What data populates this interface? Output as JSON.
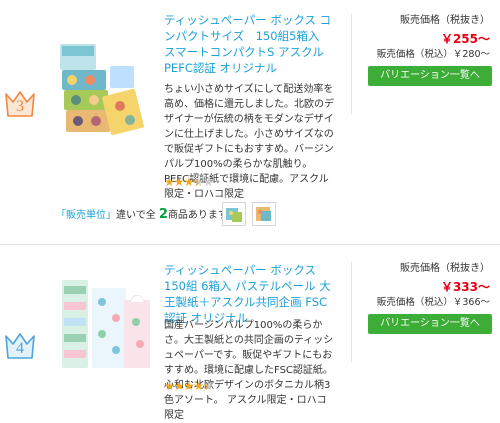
{
  "colors": {
    "link": "#1da1d8",
    "price": "#e60012",
    "button": "#3cae37",
    "star": "#f2a71d",
    "rank3": "#f1873e",
    "rank4": "#4ea3d8",
    "count": "#00a040"
  },
  "items": [
    {
      "rank": "3",
      "rank_icon": "crown-icon",
      "title": "ティッシュペーパー ボックス コンパクトサイズ　150組5箱入 スマートコンパクトS アスクル PEFC認証 オリジナル",
      "description": "ちょい小さめサイズにして配送効率を高め、価格に還元しました。北欧のデザイナーが伝統の柄をモダンなデザインに仕上げました。小さめサイズなので販促ギフトにもおすすめ。バージンパルプ100%の柔らかな肌触り。PEFC認証紙で環境に配慮。アスクル限定・ロハコ限定",
      "rating": 3.5,
      "price_label": "販売価格（税抜き）",
      "price": "￥255～",
      "price_tax_included": "販売価格（税込）￥280～",
      "button_label": "バリエーション一覧へ",
      "variant_info": {
        "unit_link": "「販売単位」",
        "text_before": "違いで全",
        "count": "2",
        "text_after": "商品あります"
      }
    },
    {
      "rank": "4",
      "rank_icon": "crown-icon",
      "title": "ティッシュペーパー ボックス　150組 6箱入 パステルペール 大王製紙＋アスクル共同企画 FSC認証 オリジナル",
      "description": "国産バージンパルプ100%の柔らかさ。大王製紙との共同企画のティッシュペーパーです。販促やギフトにもおすすめ。環境に配慮したFSC認証紙。心和む北欧デザインのボタニカル柄3色アソート。 アスクル限定・ロハコ限定",
      "rating": 4.5,
      "price_label": "販売価格（税抜き）",
      "price": "￥333～",
      "price_tax_included": "販売価格（税込）￥366～",
      "button_label": "バリエーション一覧へ"
    }
  ]
}
